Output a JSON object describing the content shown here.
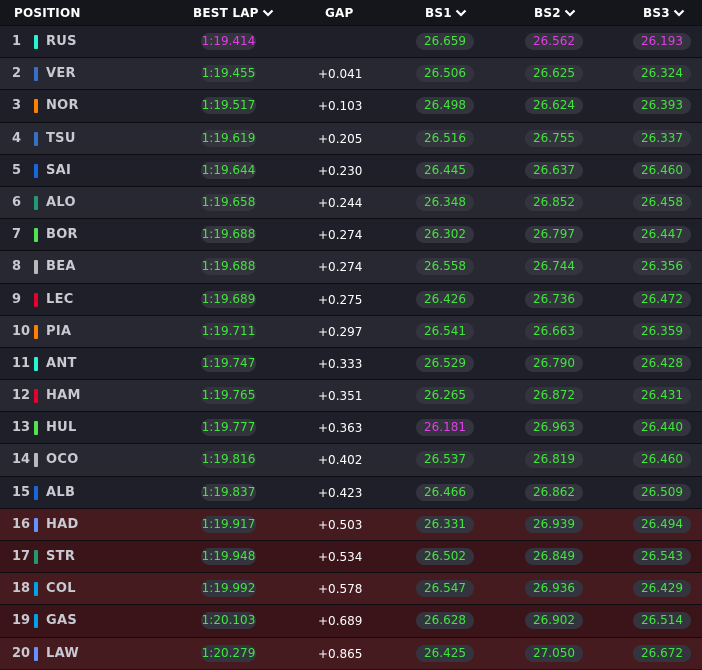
{
  "header": {
    "position": "POSITION",
    "best_lap": "BEST LAP",
    "gap": "GAP",
    "bs1": "BS1",
    "bs2": "BS2",
    "bs3": "BS3"
  },
  "colors": {
    "personal_best": "#41e63c",
    "session_best": "#e23ee6",
    "eliminated_row": "#461b1f"
  },
  "rows": [
    {
      "pos": "1",
      "driver": "RUS",
      "team_color": "#27f4d2",
      "best_lap": "1:19.414",
      "best_lap_color": "purple",
      "gap": "",
      "bs1": "26.659",
      "bs1_color": "green",
      "bs2": "26.562",
      "bs2_color": "purple",
      "bs3": "26.193",
      "bs3_color": "purple",
      "eliminated": false
    },
    {
      "pos": "2",
      "driver": "VER",
      "team_color": "#3671c6",
      "best_lap": "1:19.455",
      "best_lap_color": "green",
      "gap": "+0.041",
      "bs1": "26.506",
      "bs1_color": "green",
      "bs2": "26.625",
      "bs2_color": "green",
      "bs3": "26.324",
      "bs3_color": "green",
      "eliminated": false
    },
    {
      "pos": "3",
      "driver": "NOR",
      "team_color": "#ff8000",
      "best_lap": "1:19.517",
      "best_lap_color": "green",
      "gap": "+0.103",
      "bs1": "26.498",
      "bs1_color": "green",
      "bs2": "26.624",
      "bs2_color": "green",
      "bs3": "26.393",
      "bs3_color": "green",
      "eliminated": false
    },
    {
      "pos": "4",
      "driver": "TSU",
      "team_color": "#3671c6",
      "best_lap": "1:19.619",
      "best_lap_color": "green",
      "gap": "+0.205",
      "bs1": "26.516",
      "bs1_color": "green",
      "bs2": "26.755",
      "bs2_color": "green",
      "bs3": "26.337",
      "bs3_color": "green",
      "eliminated": false
    },
    {
      "pos": "5",
      "driver": "SAI",
      "team_color": "#1868db",
      "best_lap": "1:19.644",
      "best_lap_color": "green",
      "gap": "+0.230",
      "bs1": "26.445",
      "bs1_color": "green",
      "bs2": "26.637",
      "bs2_color": "green",
      "bs3": "26.460",
      "bs3_color": "green",
      "eliminated": false
    },
    {
      "pos": "6",
      "driver": "ALO",
      "team_color": "#229971",
      "best_lap": "1:19.658",
      "best_lap_color": "green",
      "gap": "+0.244",
      "bs1": "26.348",
      "bs1_color": "green",
      "bs2": "26.852",
      "bs2_color": "green",
      "bs3": "26.458",
      "bs3_color": "green",
      "eliminated": false
    },
    {
      "pos": "7",
      "driver": "BOR",
      "team_color": "#52e252",
      "best_lap": "1:19.688",
      "best_lap_color": "green",
      "gap": "+0.274",
      "bs1": "26.302",
      "bs1_color": "green",
      "bs2": "26.797",
      "bs2_color": "green",
      "bs3": "26.447",
      "bs3_color": "green",
      "eliminated": false
    },
    {
      "pos": "8",
      "driver": "BEA",
      "team_color": "#b6babd",
      "best_lap": "1:19.688",
      "best_lap_color": "green",
      "gap": "+0.274",
      "bs1": "26.558",
      "bs1_color": "green",
      "bs2": "26.744",
      "bs2_color": "green",
      "bs3": "26.356",
      "bs3_color": "green",
      "eliminated": false
    },
    {
      "pos": "9",
      "driver": "LEC",
      "team_color": "#e8002d",
      "best_lap": "1:19.689",
      "best_lap_color": "green",
      "gap": "+0.275",
      "bs1": "26.426",
      "bs1_color": "green",
      "bs2": "26.736",
      "bs2_color": "green",
      "bs3": "26.472",
      "bs3_color": "green",
      "eliminated": false
    },
    {
      "pos": "10",
      "driver": "PIA",
      "team_color": "#ff8000",
      "best_lap": "1:19.711",
      "best_lap_color": "green",
      "gap": "+0.297",
      "bs1": "26.541",
      "bs1_color": "green",
      "bs2": "26.663",
      "bs2_color": "green",
      "bs3": "26.359",
      "bs3_color": "green",
      "eliminated": false
    },
    {
      "pos": "11",
      "driver": "ANT",
      "team_color": "#27f4d2",
      "best_lap": "1:19.747",
      "best_lap_color": "green",
      "gap": "+0.333",
      "bs1": "26.529",
      "bs1_color": "green",
      "bs2": "26.790",
      "bs2_color": "green",
      "bs3": "26.428",
      "bs3_color": "green",
      "eliminated": false
    },
    {
      "pos": "12",
      "driver": "HAM",
      "team_color": "#e8002d",
      "best_lap": "1:19.765",
      "best_lap_color": "green",
      "gap": "+0.351",
      "bs1": "26.265",
      "bs1_color": "green",
      "bs2": "26.872",
      "bs2_color": "green",
      "bs3": "26.431",
      "bs3_color": "green",
      "eliminated": false
    },
    {
      "pos": "13",
      "driver": "HUL",
      "team_color": "#52e252",
      "best_lap": "1:19.777",
      "best_lap_color": "green",
      "gap": "+0.363",
      "bs1": "26.181",
      "bs1_color": "purple",
      "bs2": "26.963",
      "bs2_color": "green",
      "bs3": "26.440",
      "bs3_color": "green",
      "eliminated": false
    },
    {
      "pos": "14",
      "driver": "OCO",
      "team_color": "#b6babd",
      "best_lap": "1:19.816",
      "best_lap_color": "green",
      "gap": "+0.402",
      "bs1": "26.537",
      "bs1_color": "green",
      "bs2": "26.819",
      "bs2_color": "green",
      "bs3": "26.460",
      "bs3_color": "green",
      "eliminated": false
    },
    {
      "pos": "15",
      "driver": "ALB",
      "team_color": "#1868db",
      "best_lap": "1:19.837",
      "best_lap_color": "green",
      "gap": "+0.423",
      "bs1": "26.466",
      "bs1_color": "green",
      "bs2": "26.862",
      "bs2_color": "green",
      "bs3": "26.509",
      "bs3_color": "green",
      "eliminated": false
    },
    {
      "pos": "16",
      "driver": "HAD",
      "team_color": "#6692ff",
      "best_lap": "1:19.917",
      "best_lap_color": "green",
      "gap": "+0.503",
      "bs1": "26.331",
      "bs1_color": "green",
      "bs2": "26.939",
      "bs2_color": "green",
      "bs3": "26.494",
      "bs3_color": "green",
      "eliminated": true
    },
    {
      "pos": "17",
      "driver": "STR",
      "team_color": "#229971",
      "best_lap": "1:19.948",
      "best_lap_color": "green",
      "gap": "+0.534",
      "bs1": "26.502",
      "bs1_color": "green",
      "bs2": "26.849",
      "bs2_color": "green",
      "bs3": "26.543",
      "bs3_color": "green",
      "eliminated": true
    },
    {
      "pos": "18",
      "driver": "COL",
      "team_color": "#00a1e8",
      "best_lap": "1:19.992",
      "best_lap_color": "green",
      "gap": "+0.578",
      "bs1": "26.547",
      "bs1_color": "green",
      "bs2": "26.936",
      "bs2_color": "green",
      "bs3": "26.429",
      "bs3_color": "green",
      "eliminated": true
    },
    {
      "pos": "19",
      "driver": "GAS",
      "team_color": "#00a1e8",
      "best_lap": "1:20.103",
      "best_lap_color": "green",
      "gap": "+0.689",
      "bs1": "26.628",
      "bs1_color": "green",
      "bs2": "26.902",
      "bs2_color": "green",
      "bs3": "26.514",
      "bs3_color": "green",
      "eliminated": true
    },
    {
      "pos": "20",
      "driver": "LAW",
      "team_color": "#6692ff",
      "best_lap": "1:20.279",
      "best_lap_color": "green",
      "gap": "+0.865",
      "bs1": "26.425",
      "bs1_color": "green",
      "bs2": "27.050",
      "bs2_color": "green",
      "bs3": "26.672",
      "bs3_color": "green",
      "eliminated": true
    }
  ]
}
